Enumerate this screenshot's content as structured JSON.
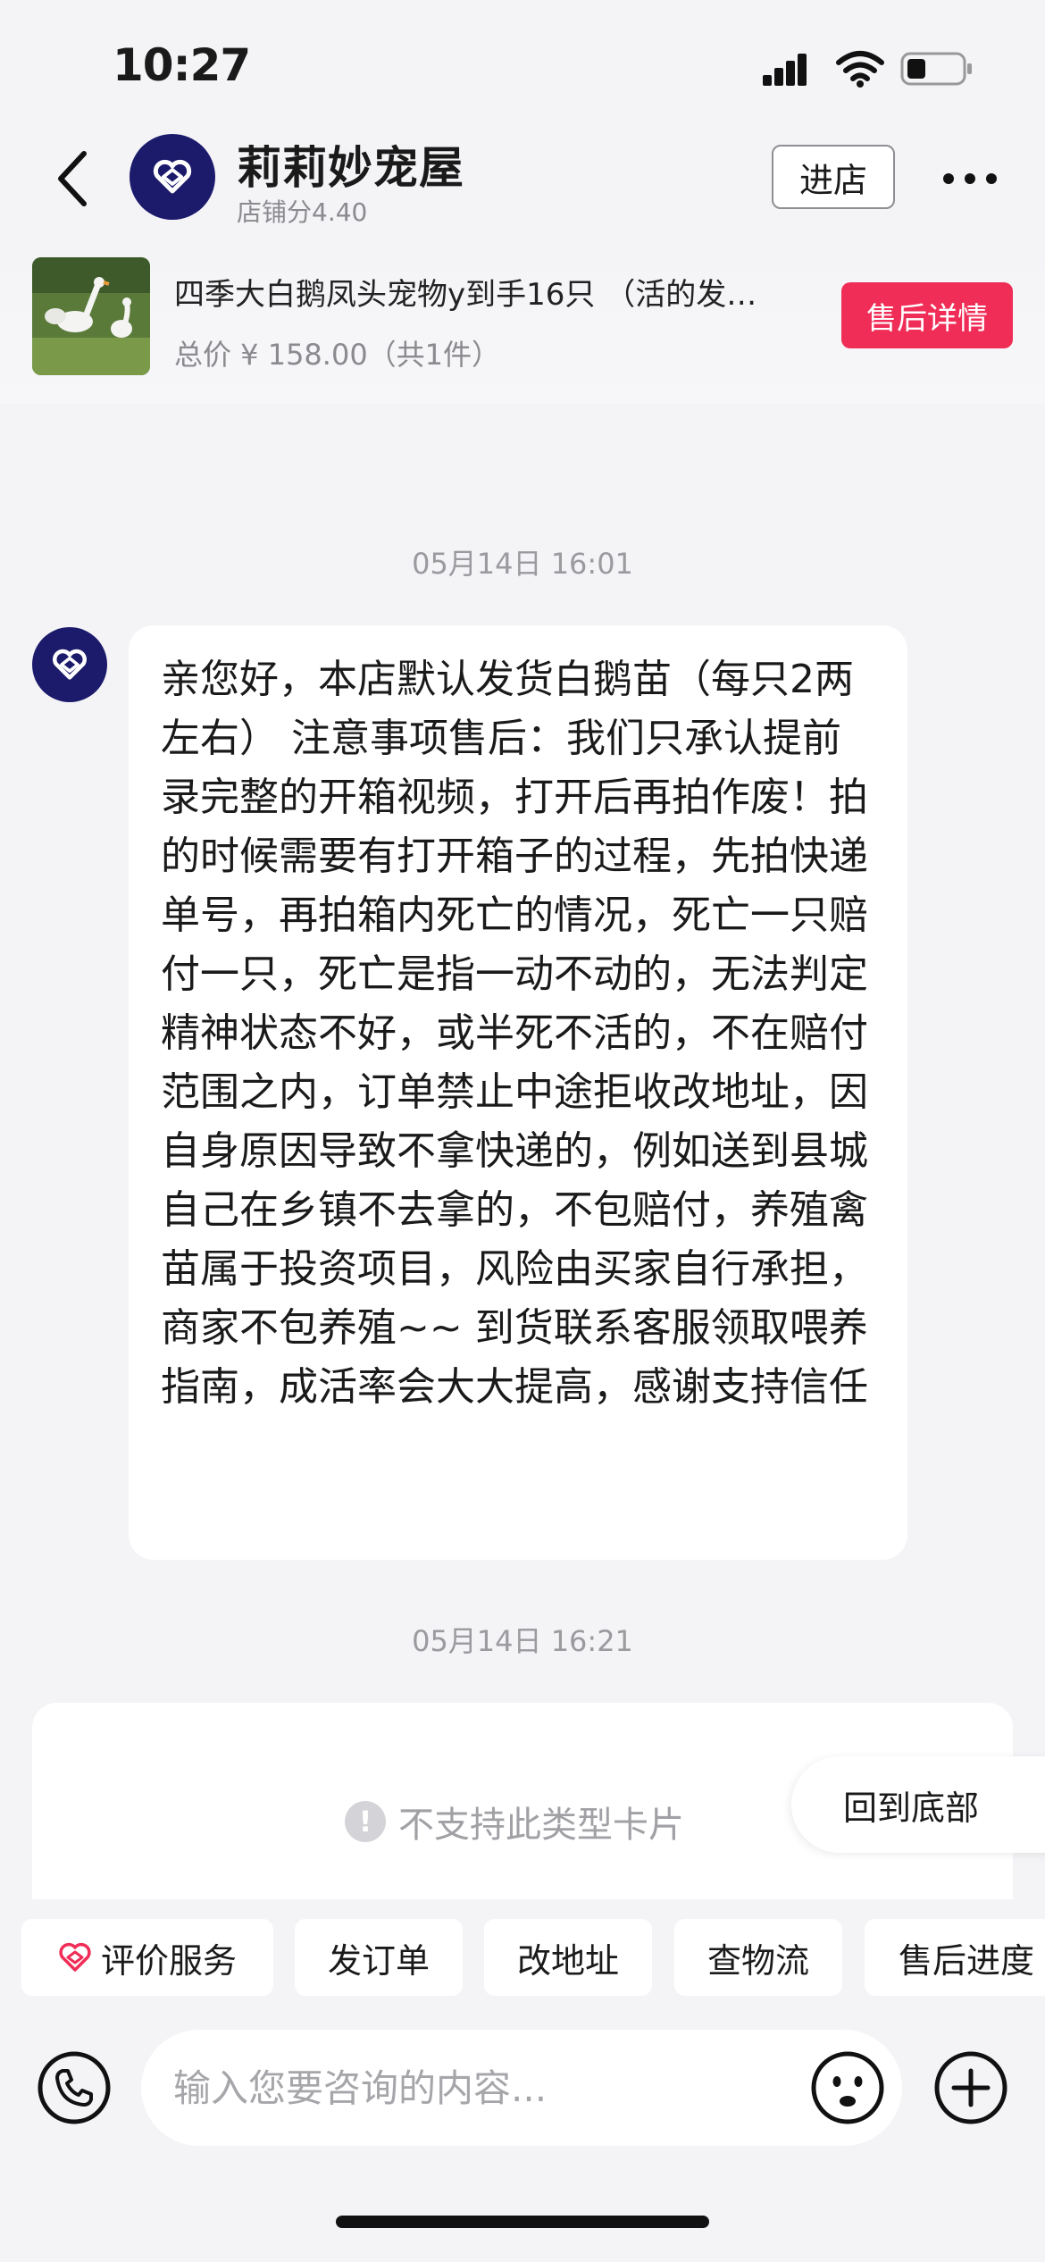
{
  "status_bar": {
    "time": "10:27"
  },
  "header": {
    "shop_name": "莉莉妙宠屋",
    "shop_score": "店铺分4.40",
    "enter_store_label": "进店"
  },
  "product": {
    "title": "四季大白鹅凤头宠物y到手16只 （活的发…",
    "price": "总价 ¥ 158.00（共1件）",
    "aftersale_label": "售后详情"
  },
  "chat": {
    "timestamp_1": "05月14日 16:01",
    "message_1": "亲您好，本店默认发货白鹅苗（每只2两左右） 注意事项售后：我们只承认提前录完整的开箱视频，打开后再拍作废！拍的时候需要有打开箱子的过程，先拍快递单号，再拍箱内死亡的情况，死亡一只赔付一只，死亡是指一动不动的，无法判定精神状态不好，或半死不活的，不在赔付范围之内，订单禁止中途拒收改地址，因自身原因导致不拿快递的，例如送到县城自己在乡镇不去拿的，不包赔付，养殖禽苗属于投资项目，风险由买家自行承担，商家不包养殖~~ 到货联系客服领取喂养指南，成活率会大大提高，感谢支持信任",
    "timestamp_2": "05月14日 16:21",
    "unsupported_card": "不支持此类型卡片",
    "back_to_bottom": "回到底部"
  },
  "quick_actions": {
    "review": "评价服务",
    "send_order": "发订单",
    "change_address": "改地址",
    "track_logistics": "查物流",
    "aftersale_progress": "售后进度"
  },
  "input": {
    "placeholder": "输入您要咨询的内容..."
  },
  "colors": {
    "accent": "#f02d57",
    "brand": "#1c1a6b",
    "background": "#f4f4f7"
  }
}
